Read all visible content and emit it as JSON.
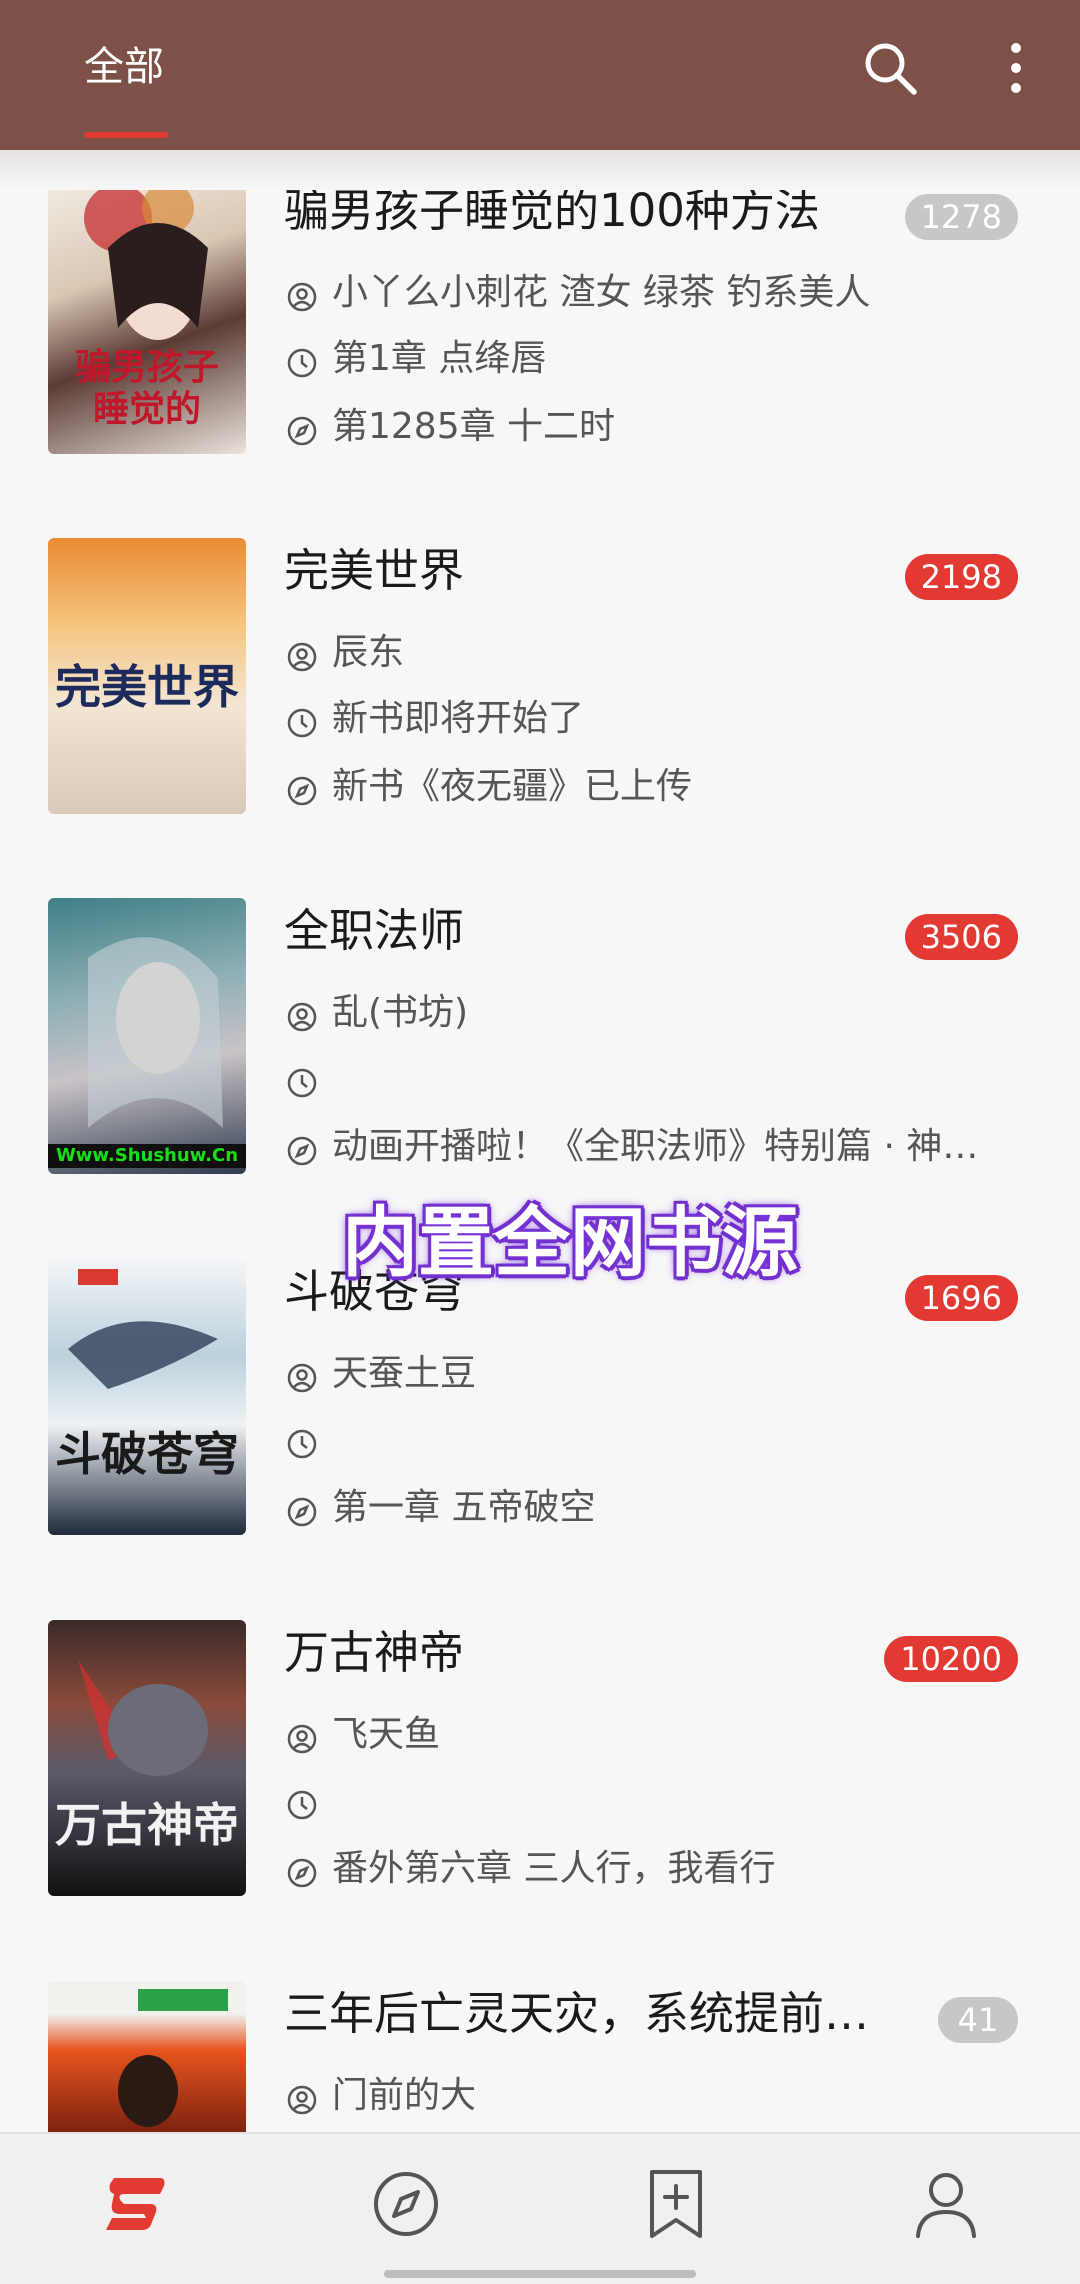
{
  "header": {
    "tab_label": "全部",
    "search_icon": "search-icon",
    "more_icon": "more-vertical-icon",
    "accent_color": "#e23a33",
    "bar_color": "#7d5148"
  },
  "books": [
    {
      "title": "骗男孩子睡觉的100种方法",
      "badge": "1278",
      "badge_color": "#c7c7c7",
      "author": "小丫么小刺花 渣女 绿茶 钓系美人",
      "last_read": "第1章 点绛唇",
      "latest": "第1285章 十二时",
      "cover_text": "骗男孩子睡觉的"
    },
    {
      "title": "完美世界",
      "badge": "2198",
      "badge_color": "#e23a33",
      "author": "辰东",
      "last_read": "新书即将开始了",
      "latest": "新书《夜无疆》已上传",
      "cover_text": "完美世界"
    },
    {
      "title": "全职法师",
      "badge": "3506",
      "badge_color": "#e23a33",
      "author": "乱(书坊)",
      "last_read": "",
      "latest": "动画开播啦！《全职法师》特别篇 · 神…",
      "cover_text": "Www.Shushuw.Cn"
    },
    {
      "title": "斗破苍穹",
      "badge": "1696",
      "badge_color": "#e23a33",
      "author": "天蚕土豆",
      "last_read": "",
      "latest": "第一章 五帝破空",
      "cover_text": "斗破苍穹"
    },
    {
      "title": "万古神帝",
      "badge": "10200",
      "badge_color": "#e23a33",
      "author": "飞天鱼",
      "last_read": "",
      "latest": "番外第六章 三人行，我看行",
      "cover_text": "万古神帝"
    },
    {
      "title": "三年后亡灵天灾，系统提前…",
      "badge": "41",
      "badge_color": "#c7c7c7",
      "author": "门前的大",
      "last_read": "",
      "latest": "",
      "cover_text": ""
    }
  ],
  "overlay": {
    "banner_text": "内置全网书源"
  },
  "bottom_nav": [
    {
      "name": "bookshelf",
      "icon": "bookshelf-icon",
      "active": true
    },
    {
      "name": "discover",
      "icon": "compass-icon",
      "active": false
    },
    {
      "name": "bookmark",
      "icon": "bookmark-add-icon",
      "active": false
    },
    {
      "name": "profile",
      "icon": "person-icon",
      "active": false
    }
  ]
}
